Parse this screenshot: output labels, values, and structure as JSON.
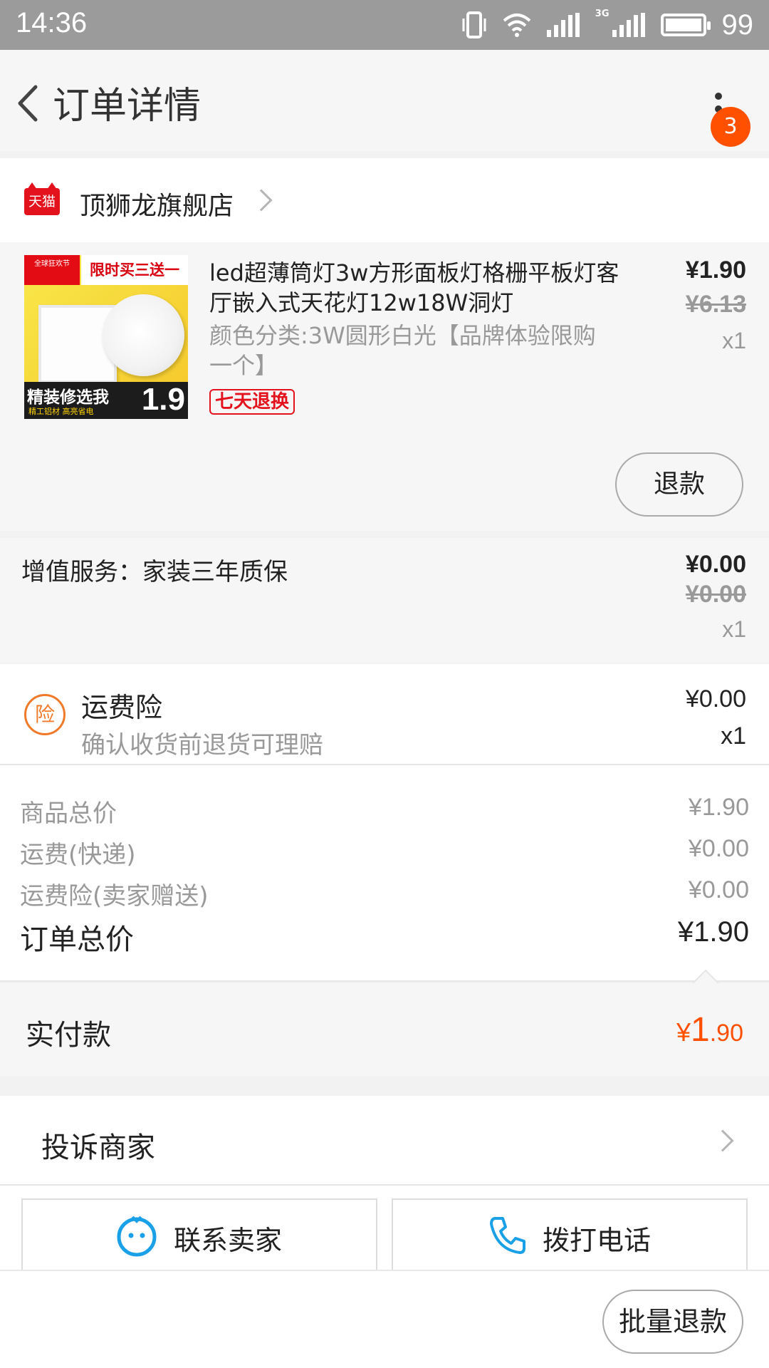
{
  "status_bar": {
    "time": "14:36",
    "network_tag": "3G",
    "battery": "99",
    "battery_level": 0.99
  },
  "header": {
    "title": "订单详情",
    "badge_count": "3"
  },
  "shop": {
    "logo_text": "天猫",
    "name": "顶狮龙旗舰店"
  },
  "product": {
    "title": "led超薄筒灯3w方形面板灯格栅平板灯客厅嵌入式天花灯12w18W洞灯",
    "spec": "颜色分类:3W圆形白光【品牌体验限购一个】",
    "tag": "七天退换",
    "price": "¥1.90",
    "original_price": "¥6.13",
    "quantity": "x1",
    "refund_button": "退款",
    "thumbnail": {
      "top_left": "全球狂欢节",
      "banner": "限时买三送一",
      "bottom_main": "精装修选我",
      "bottom_sub": "精工铝材 高亮省电",
      "price": "1.9"
    }
  },
  "service": {
    "label": "增值服务：家装三年质保",
    "price": "¥0.00",
    "original_price": "¥0.00",
    "quantity": "x1"
  },
  "insurance": {
    "icon_text": "险",
    "title": "运费险",
    "desc": "确认收货前退货可理赔",
    "price": "¥0.00",
    "quantity": "x1"
  },
  "summary": {
    "rows": [
      {
        "label": "商品总价",
        "value": "¥1.90"
      },
      {
        "label": "运费(快递)",
        "value": "¥0.00"
      },
      {
        "label": "运费险(卖家赠送)",
        "value": "¥0.00"
      }
    ],
    "total_label": "订单总价",
    "total_value": "¥1.90"
  },
  "paid": {
    "label": "实付款",
    "currency": "¥",
    "integer": "1",
    "decimal": ".90"
  },
  "complaint": {
    "label": "投诉商家"
  },
  "contact": {
    "seller_label": "联系卖家",
    "call_label": "拨打电话"
  },
  "bottom": {
    "batch_refund": "批量退款"
  },
  "colors": {
    "accent": "#ff5000",
    "tmall_red": "#e4121d",
    "insurance_orange": "#f07a2a",
    "link_blue": "#19a0e6"
  }
}
